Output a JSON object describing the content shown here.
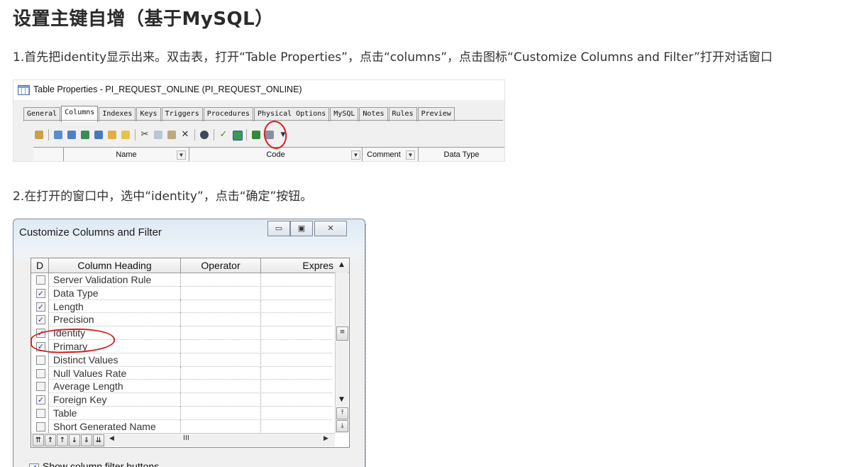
{
  "article": {
    "title": "设置主键自增（基于MySQL）",
    "step1": "1.首先把identity显示出来。双击表，打开“Table Properties”，点击“columns”，点击图标“Customize Columns and Filter”打开对话窗口",
    "step2": "2.在打开的窗口中，选中“identity”，点击“确定”按钮。"
  },
  "table_properties": {
    "window_title": "Table Properties - PI_REQUEST_ONLINE (PI_REQUEST_ONLINE)",
    "tabs": [
      "General",
      "Columns",
      "Indexes",
      "Keys",
      "Triggers",
      "Procedures",
      "Physical Options",
      "MySQL",
      "Notes",
      "Rules",
      "Preview"
    ],
    "active_tab": "Columns",
    "columns": [
      "Name",
      "Code",
      "Comment",
      "Data Type"
    ],
    "highlight_color": "#d62020"
  },
  "customize_dialog": {
    "title": "Customize Columns and Filter",
    "headers": [
      "D",
      "Column Heading",
      "Operator",
      "Expres"
    ],
    "rows": [
      {
        "label": "Server Validation Rule",
        "checked": false
      },
      {
        "label": "Data Type",
        "checked": true
      },
      {
        "label": "Length",
        "checked": true
      },
      {
        "label": "Precision",
        "checked": true
      },
      {
        "label": "Identity",
        "checked": true
      },
      {
        "label": "Primary",
        "checked": true
      },
      {
        "label": "Distinct Values",
        "checked": false
      },
      {
        "label": "Null Values Rate",
        "checked": false
      },
      {
        "label": "Average Length",
        "checked": false
      },
      {
        "label": "Foreign Key",
        "checked": true
      },
      {
        "label": "Table",
        "checked": false
      },
      {
        "label": "Short Generated Name",
        "checked": false
      }
    ],
    "hscroll_thumb": "III",
    "show_filter_label": "Show column filter buttons",
    "show_filter_checked": true
  }
}
